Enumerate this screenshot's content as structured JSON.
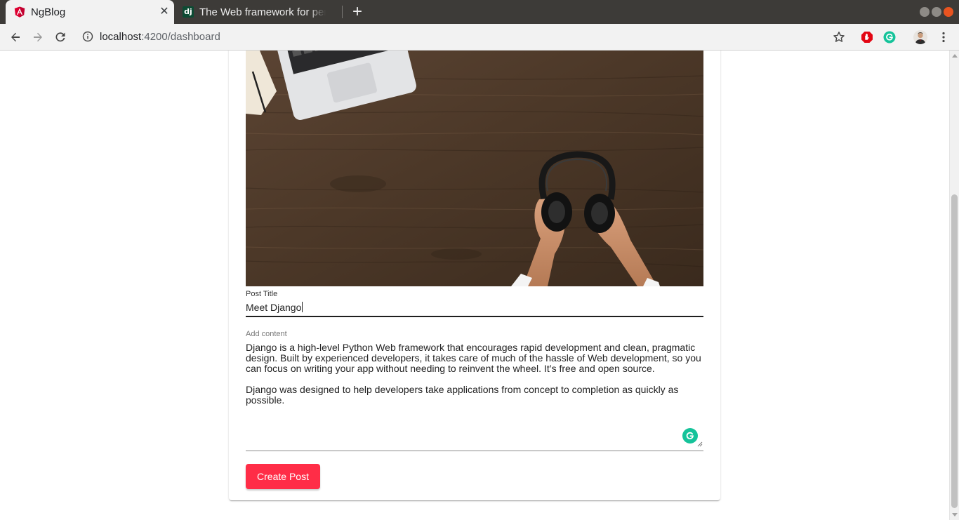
{
  "browser": {
    "tabs": [
      {
        "title": "NgBlog",
        "favicon": "angular-icon",
        "active": true
      },
      {
        "title": "The Web framework for perfectionists with deadlines",
        "favicon": "django-icon",
        "active": false
      }
    ],
    "close_glyph": "✕",
    "new_tab_glyph": "+",
    "url": {
      "host": "localhost",
      "path": ":4200/dashboard"
    }
  },
  "form": {
    "title_label": "Post Title",
    "title_value": "Meet Django",
    "content_label": "Add content",
    "content_paragraphs": [
      "Django is a high-level Python Web framework that encourages rapid development and clean, pragmatic design. Built by experienced developers, it takes care of much of the hassle of Web development, so you can focus on writing your app without needing to reinvent the wheel. It’s free and open source.",
      "Django was designed to help developers take applications from concept to completion as quickly as possible."
    ],
    "submit_label": "Create Post"
  },
  "colors": {
    "accent": "#ff2d47",
    "grammarly": "#15c39a",
    "titlebar": "#3d3b38"
  }
}
